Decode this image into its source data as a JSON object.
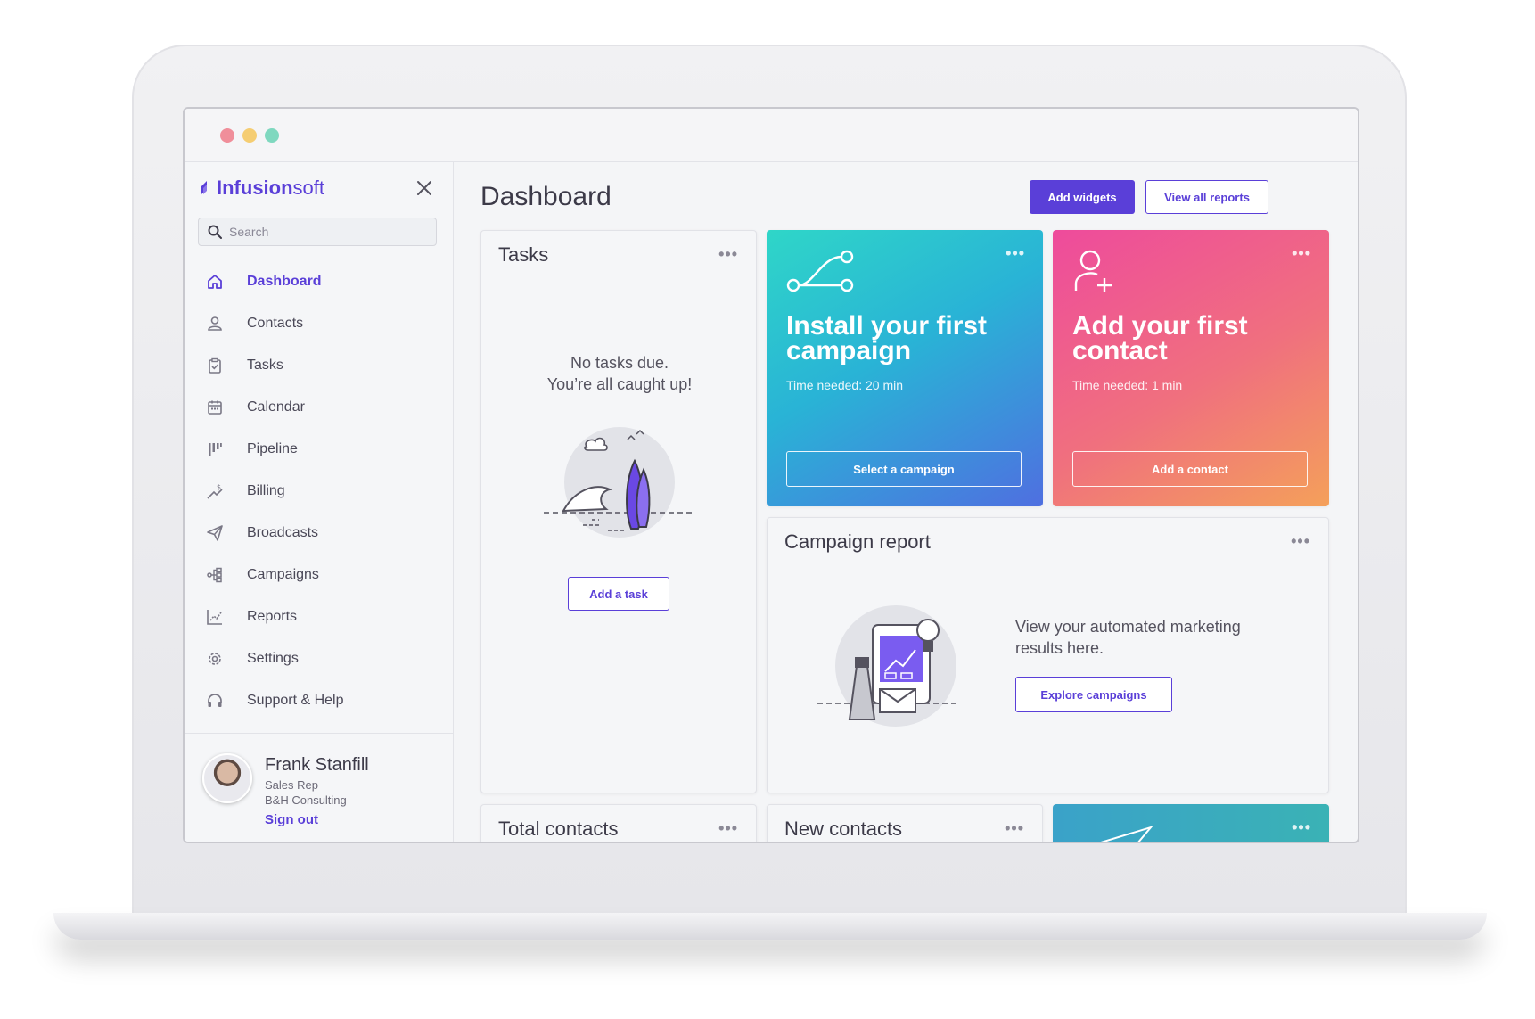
{
  "window": {
    "controls": [
      "close",
      "minimize",
      "maximize"
    ]
  },
  "sidebar": {
    "brand_bold": "Infusion",
    "brand_light": "soft",
    "search_placeholder": "Search",
    "items": [
      {
        "label": "Dashboard",
        "icon": "home-icon",
        "active": true
      },
      {
        "label": "Contacts",
        "icon": "person-icon"
      },
      {
        "label": "Tasks",
        "icon": "clipboard-check-icon"
      },
      {
        "label": "Calendar",
        "icon": "calendar-icon"
      },
      {
        "label": "Pipeline",
        "icon": "pipeline-icon"
      },
      {
        "label": "Billing",
        "icon": "billing-icon"
      },
      {
        "label": "Broadcasts",
        "icon": "paper-plane-icon"
      },
      {
        "label": "Campaigns",
        "icon": "campaign-flow-icon"
      },
      {
        "label": "Reports",
        "icon": "line-chart-icon"
      },
      {
        "label": "Settings",
        "icon": "gear-icon"
      },
      {
        "label": "Support & Help",
        "icon": "headset-icon"
      }
    ],
    "profile": {
      "name": "Frank Stanfill",
      "role": "Sales Rep",
      "company": "B&H Consulting",
      "signout": "Sign out"
    }
  },
  "header": {
    "title": "Dashboard",
    "add_widgets": "Add widgets",
    "view_reports": "View all reports"
  },
  "tasks_card": {
    "title": "Tasks",
    "empty_line1": "No tasks due.",
    "empty_line2": "You’re all caught up!",
    "button": "Add a task"
  },
  "campaign_promo": {
    "heading": "Install your first campaign",
    "time": "Time needed: 20 min",
    "button": "Select a campaign"
  },
  "contact_promo": {
    "heading": "Add your first contact",
    "time": "Time needed: 1 min",
    "button": "Add a contact"
  },
  "campaign_report": {
    "title": "Campaign report",
    "text": "View your automated marketing results here.",
    "button": "Explore campaigns"
  },
  "bottom_cards": {
    "total_contacts": "Total contacts",
    "new_contacts": "New contacts"
  },
  "more_glyph": "•••",
  "colors": {
    "accent": "#5a3fd8",
    "campaign_gradient": [
      "#2fd6c8",
      "#4f6fe0"
    ],
    "contact_gradient": [
      "#ee4b9c",
      "#f4a05a"
    ]
  }
}
